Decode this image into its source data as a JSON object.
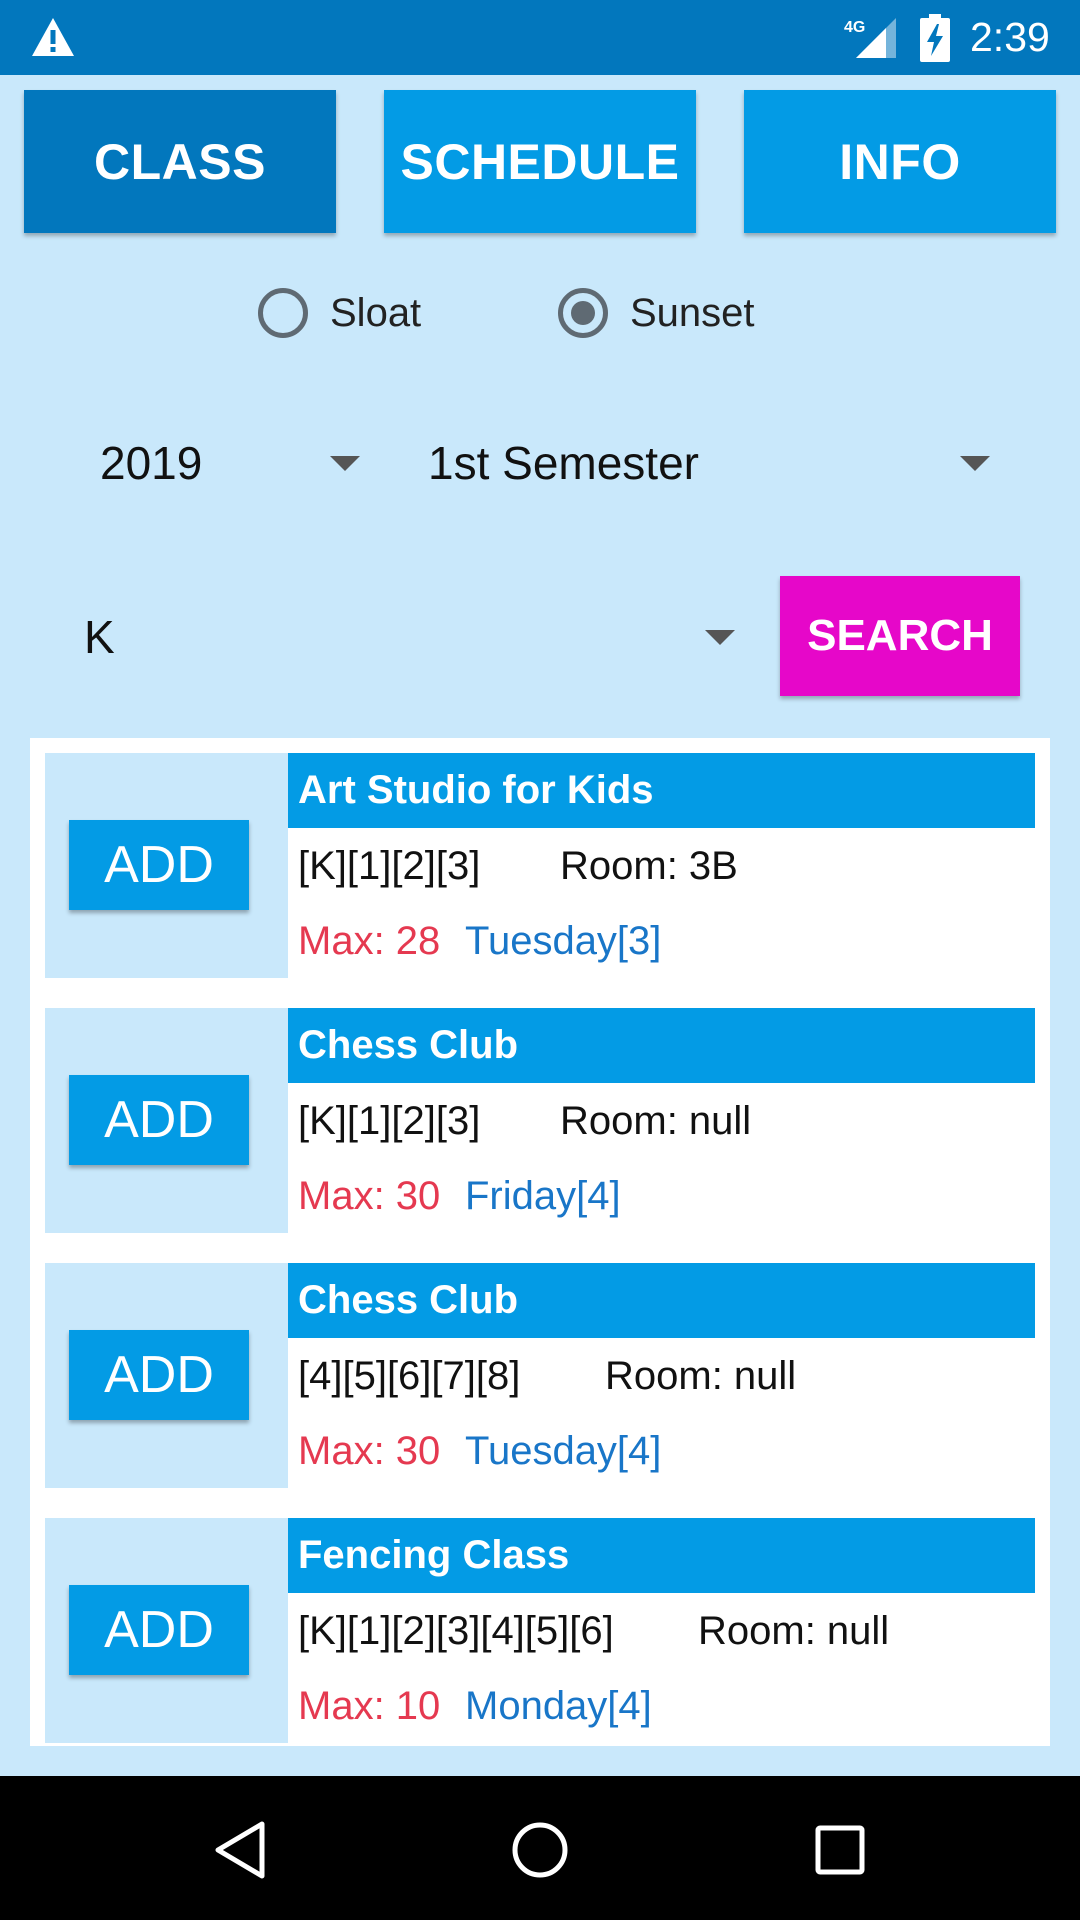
{
  "status_bar": {
    "time": "2:39",
    "network": "4G",
    "icons": [
      "warning-icon",
      "signal-icon",
      "battery-charging-icon"
    ]
  },
  "tabs": [
    {
      "label": "CLASS",
      "active": true
    },
    {
      "label": "SCHEDULE",
      "active": false
    },
    {
      "label": "INFO",
      "active": false
    }
  ],
  "campus_radio": [
    {
      "label": "Sloat",
      "selected": false
    },
    {
      "label": "Sunset",
      "selected": true
    }
  ],
  "filters": {
    "year": "2019",
    "semester": "1st Semester",
    "grade": "K",
    "search_label": "SEARCH"
  },
  "classes": [
    {
      "add_label": "ADD",
      "title": "Art Studio for Kids",
      "grades": "[K][1][2][3]",
      "room": "Room: 3B",
      "max": "Max: 28",
      "day": "Tuesday[3]"
    },
    {
      "add_label": "ADD",
      "title": "Chess Club",
      "grades": "[K][1][2][3]",
      "room": "Room: null",
      "max": "Max: 30",
      "day": "Friday[4]"
    },
    {
      "add_label": "ADD",
      "title": "Chess Club",
      "grades": "[4][5][6][7][8]",
      "room": "Room: null",
      "max": "Max: 30",
      "day": "Tuesday[4]"
    },
    {
      "add_label": "ADD",
      "title": "Fencing Class",
      "grades": "[K][1][2][3][4][5][6]",
      "room": "Room: null",
      "max": "Max: 10",
      "day": "Monday[4]"
    }
  ],
  "colors": {
    "status_bar": "#0277bd",
    "accent": "#039be5",
    "active_tab": "#0277bd",
    "background": "#c9e8fb",
    "search_button": "#e607c9",
    "max_text": "#e53950",
    "day_text": "#1976c8"
  },
  "nav_bar": {
    "icons": [
      "back-icon",
      "home-icon",
      "recents-icon"
    ]
  }
}
